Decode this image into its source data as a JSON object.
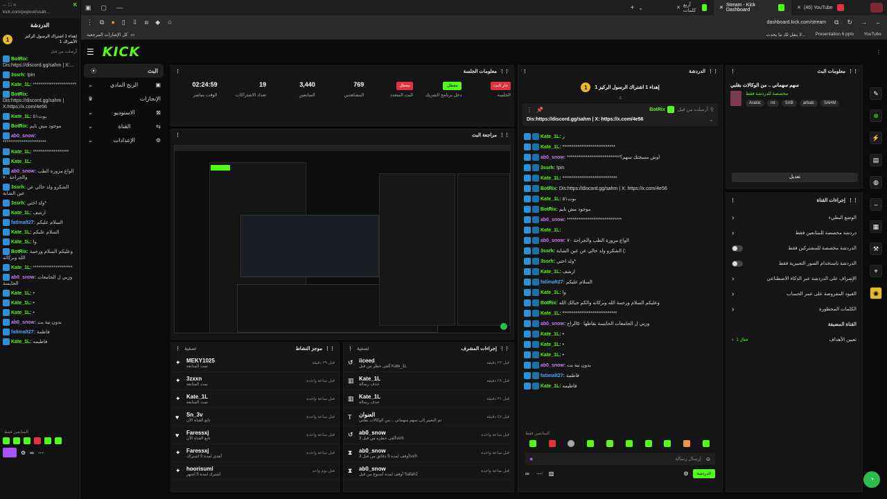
{
  "popout": {
    "url": "kick.com/popout/ssah...",
    "title": "الدردشة",
    "pinned_line1": "إهداء 1 اشتراك الرسول الركيز",
    "pinned_line2": "1 الأشراك",
    "sent_by": "أرسلت من قبل",
    "msgs": [
      {
        "user": "BotRix:",
        "text": "Dis:https://discord.gg/sahm | X:...",
        "color": "#53fc18"
      },
      {
        "user": "3ssrh:",
        "text": "!pin",
        "color": "#53fc18"
      },
      {
        "user": "Kate_1L:",
        "text": "***********************",
        "color": "#53fc18"
      },
      {
        "user": "BotRix:",
        "text": "Dis:https://discord.gg/sahm | X:https://x.com/4e56",
        "color": "#53fc18"
      },
      {
        "user": "Kate_1L:",
        "text": "بوت٥١",
        "color": "#53fc18"
      },
      {
        "user": "BotRix:",
        "text": "موجود مش نايم",
        "color": "#53fc18"
      },
      {
        "user": "ab0_snow:",
        "text": "***********************",
        "color": "#c97bff"
      },
      {
        "user": "Kate_1L:",
        "text": "*******************",
        "color": "#53fc18"
      },
      {
        "user": "Kate_1L:",
        "text": "",
        "color": "#53fc18"
      },
      {
        "user": "ab0_snow:",
        "text": "الواع مزوزة الطب والجراحة ٧٠",
        "color": "#c97bff"
      },
      {
        "user": "3ssrh:",
        "text": "الشكرو ولد خالي عن عين الشابة",
        "color": "#53fc18"
      },
      {
        "user": "3ssrh:",
        "text": "ولد اختي*",
        "color": "#53fc18"
      },
      {
        "user": "Kate_1L:",
        "text": "ارشف",
        "color": "#53fc18"
      },
      {
        "user": "fatimalt27:",
        "text": "السلام عليكم",
        "color": "#4aa3ff"
      },
      {
        "user": "Kate_1L:",
        "text": "السلام عليكم",
        "color": "#53fc18"
      },
      {
        "user": "Kate_1L:",
        "text": "وا",
        "color": "#53fc18"
      },
      {
        "user": "BotRix:",
        "text": "وعليكم السلام ورحمة الله وبركاته",
        "color": "#53fc18"
      },
      {
        "user": "Kate_1L:",
        "text": "*********************",
        "color": "#53fc18"
      },
      {
        "user": "ab0_snow:",
        "text": "وزيي ل الجامعات الحايسة",
        "color": "#c97bff"
      },
      {
        "user": "Kate_1L:",
        "text": "•",
        "color": "#53fc18"
      },
      {
        "user": "Kate_1L:",
        "text": "•",
        "color": "#53fc18"
      },
      {
        "user": "Kate_1L:",
        "text": "•",
        "color": "#53fc18"
      },
      {
        "user": "ab0_snow:",
        "text": "بدون نية بت",
        "color": "#c97bff"
      },
      {
        "user": "fatimalt27:",
        "text": "فاطمة",
        "color": "#4aa3ff"
      },
      {
        "user": "Kate_1L:",
        "text": "فاطيمه",
        "color": "#53fc18"
      }
    ],
    "followers_only": "المتابعين فقط"
  },
  "tabs": [
    {
      "label": "أربع كلمات"
    },
    {
      "label": "Stream - Kick Dashboard"
    },
    {
      "label": "(46) YouTube"
    }
  ],
  "url": "dashboard.kick.com/stream",
  "bookmarks": {
    "folder": "كل الإشارات المرجعية",
    "items": [
      "لا ينقل لك ما يحدث...",
      "Presentation 6.pptx",
      "YouTube"
    ]
  },
  "kick": {
    "logo": "KICK"
  },
  "sidenav": [
    {
      "label": "البث",
      "icon": "broadcast-icon",
      "sel": true
    },
    {
      "label": "الربح المادي",
      "icon": "chevron-icon"
    },
    {
      "label": "الإنجازات",
      "icon": "trophy-icon"
    },
    {
      "label": "الاستوديو",
      "icon": "chevron-icon"
    },
    {
      "label": "القناة",
      "icon": "chevron-icon"
    },
    {
      "label": "الإعدادات",
      "icon": "chevron-icon"
    }
  ],
  "session": {
    "title": "معلومات الجلسة",
    "stats": [
      {
        "value": "02:24:59",
        "label": "الوقت مباشر"
      },
      {
        "value": "19",
        "label": "تعداد الاشتراكات"
      },
      {
        "value": "3,440",
        "label": "المتابعين"
      },
      {
        "value": "769",
        "label": "المشاهدين"
      },
      {
        "value": "معطل",
        "label": "البث المتعدد",
        "btn": "red"
      },
      {
        "value": "معطل",
        "label": "دخل برنامج الشريك",
        "btn": "green"
      },
      {
        "value": "جار البث",
        "label": "الجلسة",
        "btn": "red"
      }
    ]
  },
  "preview": {
    "title": "مراجعة البث"
  },
  "activity": {
    "title": "موجز النشاط",
    "filter": "تصفية",
    "items": [
      {
        "name": "MEKY1025",
        "sub": "تمت المتابعة",
        "time": "قبل ٢٩ دقيقة"
      },
      {
        "name": "3zxxn",
        "sub": "تمت المتابعة",
        "time": "قبل ساعة واحدة"
      },
      {
        "name": "Kate_1L",
        "sub": "تمت المتابعة",
        "time": "قبل ساعة واحدة"
      },
      {
        "name": "Sn_3v",
        "sub": "تابع القناة الآن",
        "time": "قبل ساعة واحدة"
      },
      {
        "name": "Faressxj",
        "sub": "تابع القناة الآن",
        "time": "قبل ساعة واحدة"
      },
      {
        "name": "Faressxj",
        "sub": "أهدى لمدة 5 اشتراك",
        "time": "قبل ساعة واحدة"
      },
      {
        "name": "hoorisuml",
        "sub": "اشترك لمدة 5 أشهر",
        "time": "قبل يوم واحد"
      }
    ]
  },
  "modactions": {
    "title": "إجراءات المشرف",
    "filter": "تصفية",
    "items": [
      {
        "name": "iiceed",
        "sub": "ألغى حظر من قبل Kate_1L",
        "time": "قبل ٢٢ دقيقة"
      },
      {
        "name": "Kate_1L",
        "sub": "حذف رسالة",
        "time": "قبل ٢٨ دقيقة"
      },
      {
        "name": "Kate_1L",
        "sub": "حذف رسالة",
        "time": "قبل ٣١ دقيقة"
      },
      {
        "name": "العنوان",
        "sub": "تم التغيير إلى سهم سهماني .. من الوكالات بقلبي",
        "time": "قبل ٤٧ دقيقة"
      },
      {
        "name": "ab0_snow",
        "sub": "ألغى حظره من قبل 3ssrh",
        "time": "قبل ساعة واحدة"
      },
      {
        "name": "ab0_snow",
        "sub": "أوقف لمدة 5 دقائق من قبل 3ssrh",
        "time": "قبل ساعة واحدة"
      },
      {
        "name": "ab0_snow",
        "sub": "أوقف لمدة أسبوع من قبل Safah2",
        "time": "قبل ساعة واحدة"
      }
    ]
  },
  "chat": {
    "title": "الدردشة",
    "pinned": "إهداء 1 اشتراك الرسول الركيز 1",
    "sent_by": "أرسلت من قبل",
    "pin_user": "BotRix",
    "pin_text": "Dis:https://discord.gg/sahm | X: https://x.com/4e56",
    "msgs": [
      {
        "user": "Kate_1L:",
        "text": "ر",
        "color": "#53fc18"
      },
      {
        "user": "Kate_1L:",
        "text": "****************************",
        "color": "#53fc18"
      },
      {
        "user": "ab0_snow:",
        "text": "****************************اوش مسختك سهم؟",
        "color": "#c97bff"
      },
      {
        "user": "3ssrh:",
        "text": "!pin",
        "color": "#53fc18"
      },
      {
        "user": "Kate_1L:",
        "text": "*****************************",
        "color": "#53fc18"
      },
      {
        "user": "BotRix:",
        "text": "Dis:https://discord.gg/sahm | X: https://x.com/4e56",
        "color": "#53fc18"
      },
      {
        "user": "Kate_1L:",
        "text": "بوت٥١",
        "color": "#53fc18"
      },
      {
        "user": "BotRix:",
        "text": "موجود مش نايم",
        "color": "#53fc18"
      },
      {
        "user": "ab0_snow:",
        "text": "*****************************",
        "color": "#c97bff"
      },
      {
        "user": "Kate_1L:",
        "text": "",
        "color": "#53fc18"
      },
      {
        "user": "ab0_snow:",
        "text": "الواع مزوزة الطب والجراحة ٧٠",
        "color": "#c97bff"
      },
      {
        "user": "3ssrh:",
        "text": "الشكرو ولد خالي عن عين الشابة (:",
        "color": "#53fc18"
      },
      {
        "user": "3ssrh:",
        "text": "ولد اختي*",
        "color": "#53fc18"
      },
      {
        "user": "Kate_1L:",
        "text": "ارشف",
        "color": "#53fc18"
      },
      {
        "user": "fatimalt27:",
        "text": "السلام عليكم",
        "color": "#4aa3ff"
      },
      {
        "user": "Kate_1L:",
        "text": "وا",
        "color": "#53fc18"
      },
      {
        "user": "BotRix:",
        "text": "وعليكم السلام ورحمة الله وبركاته والكم حيالك الله",
        "color": "#53fc18"
      },
      {
        "user": "Kate_1L:",
        "text": "*****************************",
        "color": "#53fc18"
      },
      {
        "user": "ab0_snow:",
        "text": "وزيي ل الجامعات الحايسة نقاطها ٥٠الراح",
        "color": "#c97bff"
      },
      {
        "user": "Kate_1L:",
        "text": "•",
        "color": "#53fc18"
      },
      {
        "user": "Kate_1L:",
        "text": "•",
        "color": "#53fc18"
      },
      {
        "user": "Kate_1L:",
        "text": "•",
        "color": "#53fc18"
      },
      {
        "user": "ab0_snow:",
        "text": "بدون نية بت",
        "color": "#c97bff"
      },
      {
        "user": "fatimalt27:",
        "text": "فاطمة",
        "color": "#4aa3ff"
      },
      {
        "user": "Kate_1L:",
        "text": "فاطيمه",
        "color": "#53fc18"
      }
    ],
    "followers_only": "المتابعين فقط",
    "input_placeholder": "إرسال رسالة",
    "send_label": "الدردشة"
  },
  "streaminfo": {
    "title": "معلومات البث",
    "stream_title": "سهم سهماني .. من الوكالات بقلبي",
    "category": "مخصصة للدردشة فقط",
    "tags": [
      "Arabic",
      "mt",
      "SXB",
      "arbalc",
      "SAHM"
    ],
    "edit_label": "تعديل"
  },
  "channelactions": {
    "title": "إجراءات القناة",
    "rows": [
      {
        "label": "الوضع البطيء",
        "ctrl": "chevron"
      },
      {
        "label": "دردشة مخصصة للمتابعين فقط",
        "ctrl": "chevron"
      },
      {
        "label": "الدردشة مخصصة للمشتركين فقط",
        "ctrl": "toggle"
      },
      {
        "label": "الدردشة باستخدام الصور التعبيرية فقط",
        "ctrl": "toggle"
      },
      {
        "label": "الإشراف على الدردشة عبر الذكاء الاصطناعي",
        "ctrl": "chevron"
      },
      {
        "label": "القيود المفروضة على عمر الحساب",
        "ctrl": "chevron"
      },
      {
        "label": "الكلمات المحظورة",
        "ctrl": "chevron"
      }
    ],
    "hosting_label": "القناة المضيفة",
    "raid_label": "تعيين الأهداف",
    "raid_value": "فعال 1"
  }
}
